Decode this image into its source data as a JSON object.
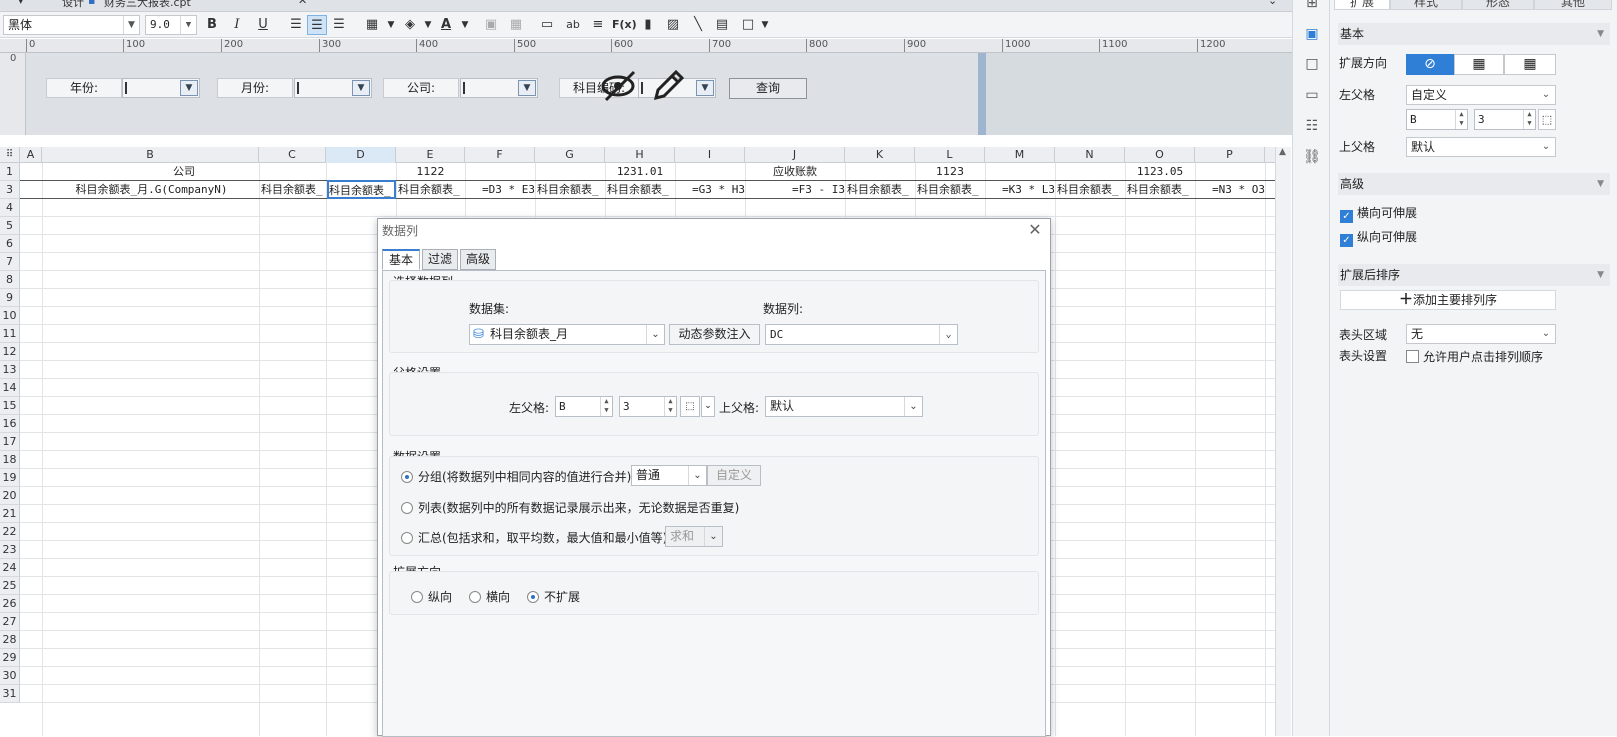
{
  "tabstrip": {
    "tab1": "设计",
    "tab2": "财务三大报表.cpt"
  },
  "toolbar": {
    "font": "黑体",
    "size": "9.0",
    "bold": "B",
    "italic": "I",
    "underline": "U",
    "abc_label": "ab",
    "fx_label": "F(x)"
  },
  "ruler": {
    "marks": [
      "0",
      "100",
      "200",
      "300",
      "400",
      "500",
      "600",
      "700",
      "800",
      "900",
      "1000",
      "1100",
      "1200"
    ],
    "vmark": "0"
  },
  "params": {
    "year_label": "年份:",
    "month_label": "月份:",
    "company_label": "公司:",
    "subject_label": "科目编码:",
    "query_button": "查询"
  },
  "grid": {
    "columns": [
      "A",
      "B",
      "C",
      "D",
      "E",
      "F",
      "G",
      "H",
      "I",
      "J",
      "K",
      "L",
      "M",
      "N",
      "O",
      "P"
    ],
    "rows": [
      "1",
      "3",
      "4",
      "5",
      "6",
      "7",
      "8",
      "9",
      "10",
      "11",
      "12",
      "13",
      "14",
      "15",
      "16",
      "17",
      "18",
      "19",
      "20",
      "21",
      "22",
      "23",
      "24",
      "25",
      "26",
      "27",
      "28",
      "29",
      "30",
      "31"
    ],
    "row1": {
      "company": "公司",
      "e": "1122",
      "gh": "1231.01",
      "j": "应收账款",
      "kl": "1123",
      "o": "1123.05"
    },
    "row3": {
      "b": "科目余额表_月.G(CompanyN)",
      "c": "科目余额表_",
      "d": "科目余额表_",
      "e": "科目余额表_",
      "f": "=D3 * E3",
      "g": "科目余额表_",
      "h": "科目余额表_",
      "i": "=G3 * H3",
      "j": "=F3 - I3",
      "k": "科目余额表_",
      "l": "科目余额表_",
      "m": "=K3 * L3",
      "n": "科目余额表_",
      "o": "科目余额表_",
      "p": "=N3 * O3"
    }
  },
  "rpanel": {
    "tabs": [
      "扩展",
      "样式",
      "形态",
      "其他"
    ],
    "basic": "基本",
    "expand_dir": "扩展方向",
    "left_parent": "左父格",
    "left_parent_value": "自定义",
    "left_col": "B",
    "left_row": "3",
    "top_parent": "上父格",
    "top_parent_value": "默认",
    "advanced": "高级",
    "h_expand": "横向可伸展",
    "v_expand": "纵向可伸展",
    "sort_after": "扩展后排序",
    "add_sort": "添加主要排列序",
    "header_area": "表头区域",
    "header_area_value": "无",
    "header_setting": "表头设置",
    "allow_user_sort": "允许用户点击排列顺序"
  },
  "dialog": {
    "title": "数据列",
    "tabs": [
      "基本",
      "过滤",
      "高级"
    ],
    "select_column": "选择数据列",
    "dataset_label": "数据集:",
    "column_label": "数据列:",
    "dataset_value": "科目余额表_月",
    "dynamic_param": "动态参数注入",
    "column_value": "DC",
    "parent_settings": "父格设置",
    "left_parent": "左父格:",
    "left_col": "B",
    "left_row": "3",
    "top_parent": "上父格:",
    "top_parent_value": "默认",
    "data_settings": "数据设置",
    "group_option": "分组(将数据列中相同内容的值进行合并)",
    "group_mode": "普通",
    "custom": "自定义",
    "list_option": "列表(数据列中的所有数据记录展示出来，无论数据是否重复)",
    "summary_option": "汇总(包括求和，取平均数，最大值和最小值等)",
    "summary_mode": "求和",
    "expand_dir": "扩展方向",
    "vertical": "纵向",
    "horizontal": "横向",
    "no_expand": "不扩展"
  },
  "colors": {
    "accent": "#2f7fd6",
    "selected_cell": "#3a7fcf"
  }
}
